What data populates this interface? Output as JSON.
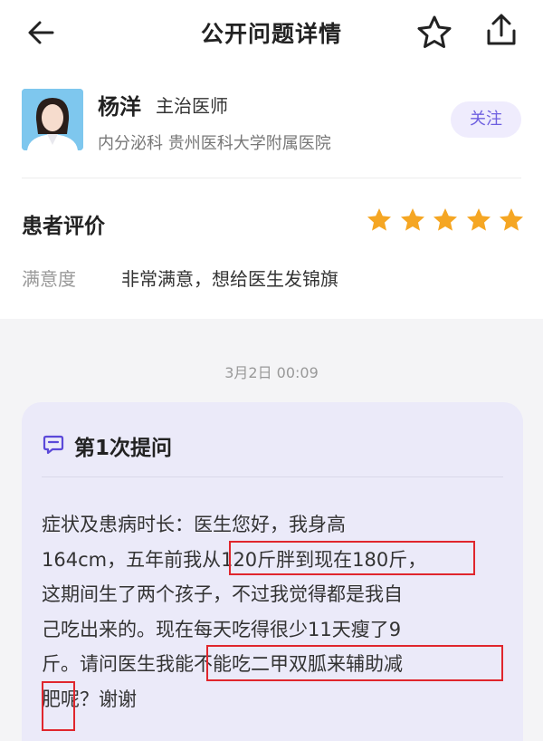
{
  "header": {
    "title": "公开问题详情",
    "back_icon": "back-arrow-icon",
    "favorite_icon": "star-outline-icon",
    "share_icon": "share-icon"
  },
  "doctor": {
    "name": "杨洋",
    "title": "主治医师",
    "department_hospital": "内分泌科 贵州医科大学附属医院",
    "follow_label": "关注"
  },
  "evaluation": {
    "heading": "患者评价",
    "stars": 5,
    "star_color": "#f5a623",
    "satisfaction_label": "满意度",
    "satisfaction_value": "非常满意，想给医生发锦旗"
  },
  "conversation": {
    "timestamp": "3月2日 00:09",
    "question": {
      "title": "第1次提问",
      "icon": "chat-bubble-icon",
      "lines": [
        "症状及患病时长：医生您好，我身高",
        "164cm，五年前我从120斤胖到现在180斤，",
        "这期间生了两个孩子，不过我觉得都是我自",
        "己吃出来的。现在每天吃得很少11天瘦了9",
        "斤。请问医生我能不能吃二甲双胍来辅助减",
        "肥呢？谢谢"
      ]
    }
  },
  "colors": {
    "accent": "#6e5fe0",
    "follow_bg": "#efecfd",
    "card_bg": "#ebeaf9",
    "highlight_box": "#e0262d"
  }
}
